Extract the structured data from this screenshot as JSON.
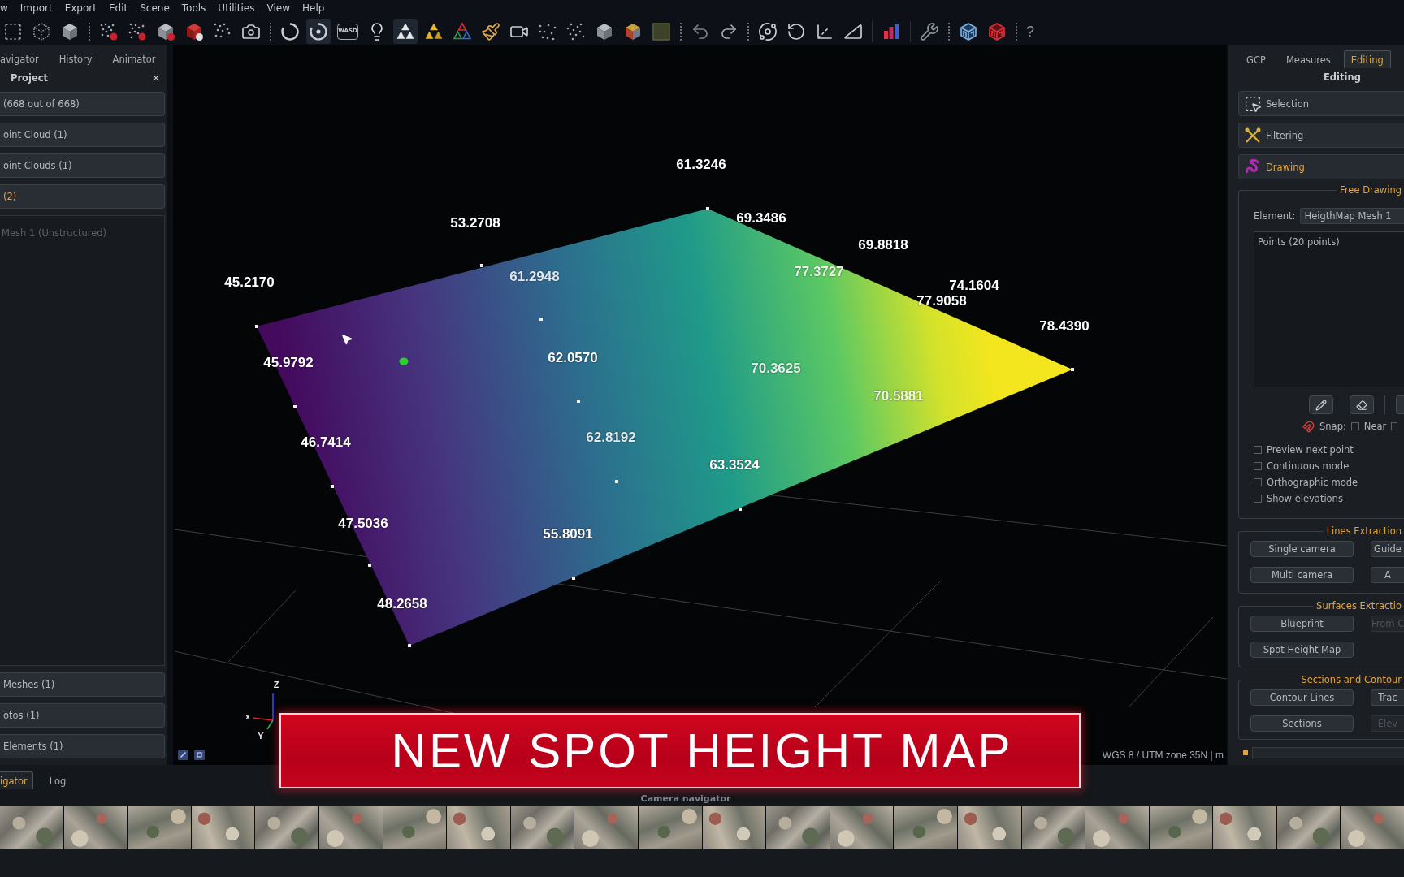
{
  "menu": [
    "w",
    "Import",
    "Export",
    "Edit",
    "Scene",
    "Tools",
    "Utilities",
    "View",
    "Help"
  ],
  "toolbar": [
    {
      "kind": "icon",
      "on": false
    },
    {
      "kind": "icon",
      "on": false
    },
    {
      "kind": "icon",
      "on": false
    },
    {
      "kind": "separator"
    },
    {
      "kind": "icon",
      "on": false
    },
    {
      "kind": "icon",
      "on": false
    },
    {
      "kind": "icon",
      "on": false
    },
    {
      "kind": "icon",
      "on": false
    },
    {
      "kind": "icon",
      "on": false
    },
    {
      "kind": "icon",
      "on": false
    },
    {
      "kind": "separator"
    },
    {
      "kind": "icon",
      "on": false
    },
    {
      "kind": "icon",
      "on": true
    },
    {
      "kind": "key",
      "label": "WASD",
      "on": false
    },
    {
      "kind": "icon",
      "on": false
    },
    {
      "kind": "icon",
      "on": true
    },
    {
      "kind": "icon",
      "on": false
    },
    {
      "kind": "icon",
      "on": false
    },
    {
      "kind": "icon",
      "on": false
    },
    {
      "kind": "icon",
      "on": false
    },
    {
      "kind": "icon",
      "on": false
    },
    {
      "kind": "icon",
      "on": false
    },
    {
      "kind": "icon",
      "on": false
    },
    {
      "kind": "icon",
      "on": false
    },
    {
      "kind": "icon",
      "on": false
    },
    {
      "kind": "separator"
    },
    {
      "kind": "icon",
      "on": false
    },
    {
      "kind": "icon",
      "on": false
    },
    {
      "kind": "separator"
    },
    {
      "kind": "icon",
      "on": false
    },
    {
      "kind": "icon",
      "on": false
    },
    {
      "kind": "icon",
      "on": false
    },
    {
      "kind": "icon",
      "on": false
    },
    {
      "kind": "divider"
    },
    {
      "kind": "icon",
      "on": false
    },
    {
      "kind": "divider"
    },
    {
      "kind": "icon",
      "on": false
    },
    {
      "kind": "separator"
    },
    {
      "kind": "icon",
      "on": false
    },
    {
      "kind": "icon",
      "on": false
    },
    {
      "kind": "separator"
    },
    {
      "kind": "text",
      "label": "?",
      "on": false
    }
  ],
  "left_panel": {
    "tabs": [
      "avigator",
      "History",
      "Animator"
    ],
    "title": "Project",
    "close": "×",
    "sections": [
      {
        "label": "(668 out of 668)",
        "expanded": false
      },
      {
        "label": "oint Cloud (1)",
        "expanded": false
      },
      {
        "label": "oint Clouds (1)",
        "expanded": false
      },
      {
        "label": "(2)",
        "expanded": true,
        "children": [
          {
            "label": "Mesh 1 (Unstructured)"
          }
        ]
      },
      {
        "label": "Meshes (1)",
        "expanded": false
      },
      {
        "label": "otos (1)",
        "expanded": false
      },
      {
        "label": "Elements (1)",
        "expanded": false
      }
    ]
  },
  "viewport": {
    "elevation_labels": [
      "61.3246",
      "53.2708",
      "69.3486",
      "69.8818",
      "45.2170",
      "61.2948",
      "77.3727",
      "74.1604",
      "77.9058",
      "78.4390",
      "45.9792",
      "62.0570",
      "70.3625",
      "70.5881",
      "46.7414",
      "62.8192",
      "63.3524",
      "47.5036",
      "55.8091",
      "48.2658"
    ],
    "axis_labels": [
      "Z",
      "x",
      "Y"
    ],
    "crs": "WGS 8 / UTM zone 35N | m"
  },
  "right_panel": {
    "tabs": [
      {
        "label": "GCP",
        "selected": false
      },
      {
        "label": "Measures",
        "selected": false
      },
      {
        "label": "Editing",
        "selected": true
      }
    ],
    "title": "Editing",
    "tools": [
      {
        "label": "Selection",
        "expanded": false
      },
      {
        "label": "Filtering",
        "expanded": false
      },
      {
        "label": "Drawing",
        "expanded": true
      }
    ],
    "free_drawing": {
      "title": "Free Drawing",
      "element_label": "Element:",
      "element_value": "HeigthMap Mesh 1",
      "list_title": "Points (20 points)",
      "snap_label": "Snap:",
      "snap_options": [
        {
          "label": "Near",
          "checked": false
        },
        {
          "checked": false
        }
      ],
      "options": [
        {
          "label": "Preview next point",
          "checked": false
        },
        {
          "label": "Continuous mode",
          "checked": false
        },
        {
          "label": "Orthographic mode",
          "checked": false
        },
        {
          "label": "Show elevations",
          "checked": false
        }
      ]
    },
    "groups": [
      {
        "title": "Lines Extraction",
        "buttons": [
          {
            "label": "Single camera",
            "disabled": false
          },
          {
            "label": "Guide",
            "disabled": false
          },
          {
            "label": "Multi camera",
            "disabled": false
          },
          {
            "label": "A",
            "disabled": false
          }
        ]
      },
      {
        "title": "Surfaces Extractio",
        "buttons": [
          {
            "label": "Blueprint",
            "disabled": false
          },
          {
            "label": "From C",
            "disabled": true
          },
          {
            "label": "Spot Height Map",
            "disabled": false
          }
        ]
      },
      {
        "title": "Sections and Contour",
        "buttons": [
          {
            "label": "Contour Lines",
            "disabled": false
          },
          {
            "label": "Trac",
            "disabled": false
          },
          {
            "label": "Sections",
            "disabled": false
          },
          {
            "label": "Elev",
            "disabled": true
          }
        ]
      }
    ]
  },
  "title_banner": {
    "text": "NEW SPOT HEIGHT MAP"
  },
  "bottom_tabs": [
    {
      "label": "igator",
      "selected": true
    },
    {
      "label": "Log",
      "selected": false
    }
  ],
  "camera_navigator": {
    "title": "Camera navigator",
    "photos": [
      {
        "kind": "photo"
      },
      {
        "kind": "photo"
      },
      {
        "kind": "photo"
      },
      {
        "kind": "photo"
      },
      {
        "kind": "photo"
      },
      {
        "kind": "photo"
      },
      {
        "kind": "photo"
      },
      {
        "kind": "photo"
      },
      {
        "kind": "photo"
      },
      {
        "kind": "photo"
      },
      {
        "kind": "photo"
      },
      {
        "kind": "photo"
      },
      {
        "kind": "photo"
      },
      {
        "kind": "photo"
      },
      {
        "kind": "photo"
      },
      {
        "kind": "photo"
      },
      {
        "kind": "photo"
      },
      {
        "kind": "photo"
      },
      {
        "kind": "photo"
      },
      {
        "kind": "photo"
      },
      {
        "kind": "photo"
      },
      {
        "kind": "photo"
      }
    ]
  }
}
